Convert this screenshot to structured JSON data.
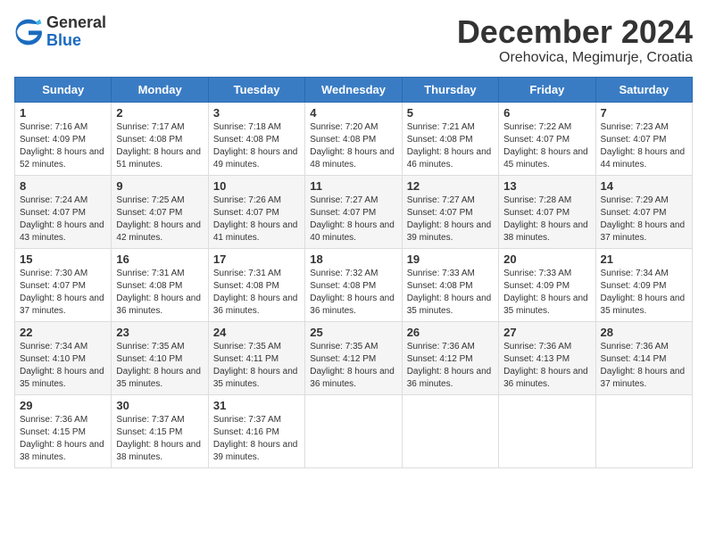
{
  "header": {
    "logo_general": "General",
    "logo_blue": "Blue",
    "month_title": "December 2024",
    "location": "Orehovica, Megimurje, Croatia"
  },
  "weekdays": [
    "Sunday",
    "Monday",
    "Tuesday",
    "Wednesday",
    "Thursday",
    "Friday",
    "Saturday"
  ],
  "weeks": [
    [
      {
        "day": "1",
        "sunrise": "7:16 AM",
        "sunset": "4:09 PM",
        "daylight": "8 hours and 52 minutes."
      },
      {
        "day": "2",
        "sunrise": "7:17 AM",
        "sunset": "4:08 PM",
        "daylight": "8 hours and 51 minutes."
      },
      {
        "day": "3",
        "sunrise": "7:18 AM",
        "sunset": "4:08 PM",
        "daylight": "8 hours and 49 minutes."
      },
      {
        "day": "4",
        "sunrise": "7:20 AM",
        "sunset": "4:08 PM",
        "daylight": "8 hours and 48 minutes."
      },
      {
        "day": "5",
        "sunrise": "7:21 AM",
        "sunset": "4:08 PM",
        "daylight": "8 hours and 46 minutes."
      },
      {
        "day": "6",
        "sunrise": "7:22 AM",
        "sunset": "4:07 PM",
        "daylight": "8 hours and 45 minutes."
      },
      {
        "day": "7",
        "sunrise": "7:23 AM",
        "sunset": "4:07 PM",
        "daylight": "8 hours and 44 minutes."
      }
    ],
    [
      {
        "day": "8",
        "sunrise": "7:24 AM",
        "sunset": "4:07 PM",
        "daylight": "8 hours and 43 minutes."
      },
      {
        "day": "9",
        "sunrise": "7:25 AM",
        "sunset": "4:07 PM",
        "daylight": "8 hours and 42 minutes."
      },
      {
        "day": "10",
        "sunrise": "7:26 AM",
        "sunset": "4:07 PM",
        "daylight": "8 hours and 41 minutes."
      },
      {
        "day": "11",
        "sunrise": "7:27 AM",
        "sunset": "4:07 PM",
        "daylight": "8 hours and 40 minutes."
      },
      {
        "day": "12",
        "sunrise": "7:27 AM",
        "sunset": "4:07 PM",
        "daylight": "8 hours and 39 minutes."
      },
      {
        "day": "13",
        "sunrise": "7:28 AM",
        "sunset": "4:07 PM",
        "daylight": "8 hours and 38 minutes."
      },
      {
        "day": "14",
        "sunrise": "7:29 AM",
        "sunset": "4:07 PM",
        "daylight": "8 hours and 37 minutes."
      }
    ],
    [
      {
        "day": "15",
        "sunrise": "7:30 AM",
        "sunset": "4:07 PM",
        "daylight": "8 hours and 37 minutes."
      },
      {
        "day": "16",
        "sunrise": "7:31 AM",
        "sunset": "4:08 PM",
        "daylight": "8 hours and 36 minutes."
      },
      {
        "day": "17",
        "sunrise": "7:31 AM",
        "sunset": "4:08 PM",
        "daylight": "8 hours and 36 minutes."
      },
      {
        "day": "18",
        "sunrise": "7:32 AM",
        "sunset": "4:08 PM",
        "daylight": "8 hours and 36 minutes."
      },
      {
        "day": "19",
        "sunrise": "7:33 AM",
        "sunset": "4:08 PM",
        "daylight": "8 hours and 35 minutes."
      },
      {
        "day": "20",
        "sunrise": "7:33 AM",
        "sunset": "4:09 PM",
        "daylight": "8 hours and 35 minutes."
      },
      {
        "day": "21",
        "sunrise": "7:34 AM",
        "sunset": "4:09 PM",
        "daylight": "8 hours and 35 minutes."
      }
    ],
    [
      {
        "day": "22",
        "sunrise": "7:34 AM",
        "sunset": "4:10 PM",
        "daylight": "8 hours and 35 minutes."
      },
      {
        "day": "23",
        "sunrise": "7:35 AM",
        "sunset": "4:10 PM",
        "daylight": "8 hours and 35 minutes."
      },
      {
        "day": "24",
        "sunrise": "7:35 AM",
        "sunset": "4:11 PM",
        "daylight": "8 hours and 35 minutes."
      },
      {
        "day": "25",
        "sunrise": "7:35 AM",
        "sunset": "4:12 PM",
        "daylight": "8 hours and 36 minutes."
      },
      {
        "day": "26",
        "sunrise": "7:36 AM",
        "sunset": "4:12 PM",
        "daylight": "8 hours and 36 minutes."
      },
      {
        "day": "27",
        "sunrise": "7:36 AM",
        "sunset": "4:13 PM",
        "daylight": "8 hours and 36 minutes."
      },
      {
        "day": "28",
        "sunrise": "7:36 AM",
        "sunset": "4:14 PM",
        "daylight": "8 hours and 37 minutes."
      }
    ],
    [
      {
        "day": "29",
        "sunrise": "7:36 AM",
        "sunset": "4:15 PM",
        "daylight": "8 hours and 38 minutes."
      },
      {
        "day": "30",
        "sunrise": "7:37 AM",
        "sunset": "4:15 PM",
        "daylight": "8 hours and 38 minutes."
      },
      {
        "day": "31",
        "sunrise": "7:37 AM",
        "sunset": "4:16 PM",
        "daylight": "8 hours and 39 minutes."
      },
      null,
      null,
      null,
      null
    ]
  ]
}
